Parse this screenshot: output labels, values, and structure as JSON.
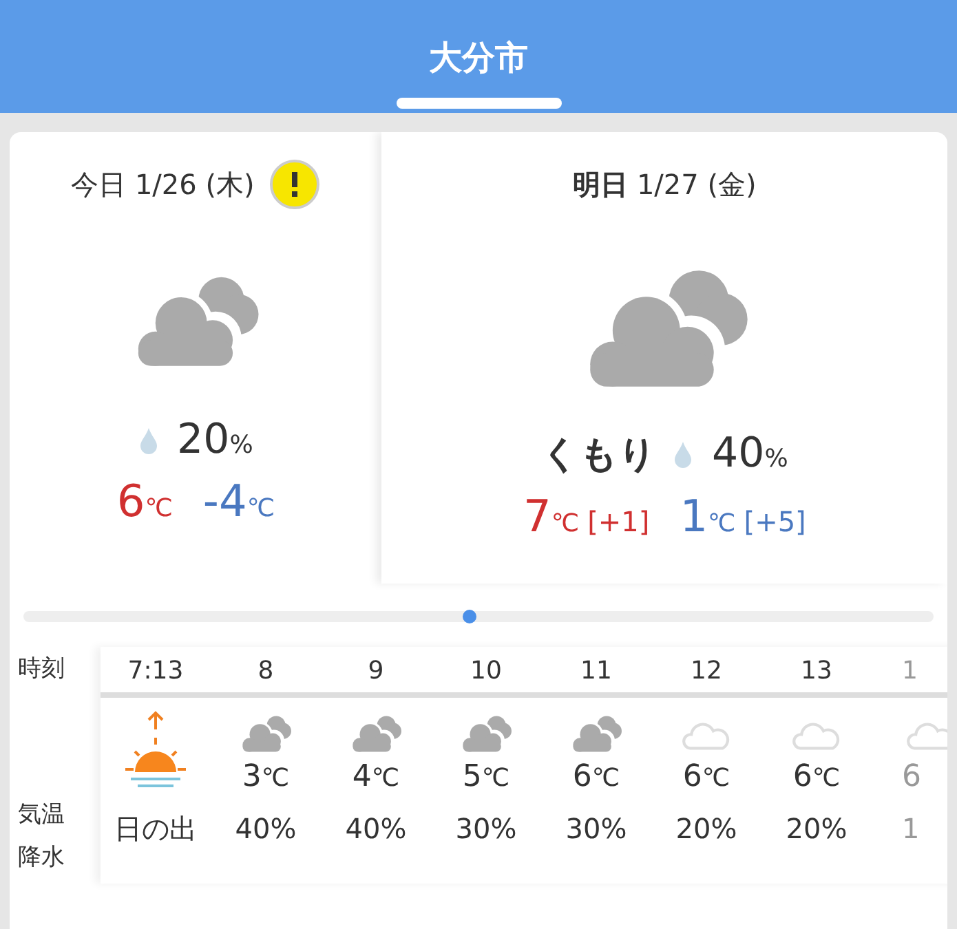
{
  "header": {
    "title": "大分市",
    "tab_selected": true
  },
  "days": [
    {
      "label": "今日",
      "bold_label": false,
      "date": "1/26 (木)",
      "warning": true,
      "kind": "cloudy",
      "pop": "20",
      "pop_unit": "%",
      "high": {
        "value": "6",
        "unit": "℃"
      },
      "low": {
        "value": "-4",
        "unit": "℃"
      }
    },
    {
      "label": "明日",
      "bold_label": true,
      "date": "1/27 (金)",
      "warning": false,
      "kind": "cloudy",
      "weather": "くもり",
      "pop": "40",
      "pop_unit": "%",
      "high": {
        "value": "7",
        "unit": "℃",
        "diff": "[+1]"
      },
      "low": {
        "value": "1",
        "unit": "℃",
        "diff": "[+5]"
      }
    }
  ],
  "timeline": {
    "level": 0.49
  },
  "hourly": {
    "row_labels": [
      "時刻",
      "気温",
      "降水"
    ],
    "columns": [
      {
        "time": "7:13",
        "kind": "sunrise",
        "pop": "日の出",
        "faded": false
      },
      {
        "time": "8",
        "kind": "cloudy",
        "temp": "3",
        "unit": "℃",
        "pop": "40%",
        "faded": false
      },
      {
        "time": "9",
        "kind": "cloudy",
        "temp": "4",
        "unit": "℃",
        "pop": "40%",
        "faded": false
      },
      {
        "time": "10",
        "kind": "cloudy",
        "temp": "5",
        "unit": "℃",
        "pop": "30%",
        "faded": false
      },
      {
        "time": "11",
        "kind": "cloudy",
        "temp": "6",
        "unit": "℃",
        "pop": "30%",
        "faded": false
      },
      {
        "time": "12",
        "kind": "cloud-light",
        "temp": "6",
        "unit": "℃",
        "pop": "20%",
        "faded": false
      },
      {
        "time": "13",
        "kind": "cloud-light",
        "temp": "6",
        "unit": "℃",
        "pop": "20%",
        "faded": false
      },
      {
        "time": "1",
        "kind": "cloud-light",
        "temp": "6",
        "pop": "1",
        "faded": true
      }
    ]
  }
}
